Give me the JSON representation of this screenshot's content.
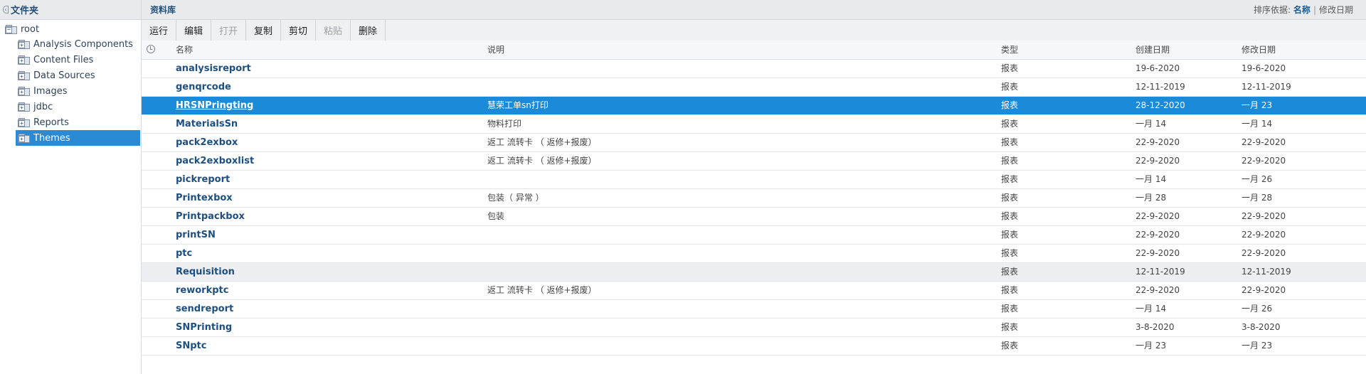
{
  "left_pane": {
    "title": "文件夹",
    "tree": [
      {
        "label": "root",
        "level": 0,
        "expanded": true,
        "selected": false
      },
      {
        "label": "Analysis Components",
        "level": 1,
        "expanded": false,
        "selected": false
      },
      {
        "label": "Content Files",
        "level": 1,
        "expanded": false,
        "selected": false
      },
      {
        "label": "Data Sources",
        "level": 1,
        "expanded": false,
        "selected": false
      },
      {
        "label": "Images",
        "level": 1,
        "expanded": false,
        "selected": false
      },
      {
        "label": "jdbc",
        "level": 1,
        "expanded": false,
        "selected": false
      },
      {
        "label": "Reports",
        "level": 1,
        "expanded": false,
        "selected": false
      },
      {
        "label": "Themes",
        "level": 1,
        "expanded": false,
        "selected": true
      }
    ]
  },
  "header": {
    "title": "资料库",
    "sort_label": "排序依据:",
    "sort_by_name": "名称",
    "sort_separator": "|",
    "sort_by_date": "修改日期"
  },
  "toolbar": {
    "buttons": [
      {
        "label": "运行",
        "enabled": true
      },
      {
        "label": "编辑",
        "enabled": true
      },
      {
        "label": "打开",
        "enabled": false
      },
      {
        "label": "复制",
        "enabled": true
      },
      {
        "label": "剪切",
        "enabled": true
      },
      {
        "label": "粘贴",
        "enabled": false
      },
      {
        "label": "删除",
        "enabled": true
      }
    ]
  },
  "table": {
    "columns": {
      "name": "名称",
      "description": "说明",
      "type": "类型",
      "created": "创建日期",
      "modified": "修改日期"
    },
    "rows": [
      {
        "name": "analysisreport",
        "description": "",
        "type": "报表",
        "created": "19-6-2020",
        "modified": "19-6-2020",
        "state": "normal"
      },
      {
        "name": "genqrcode",
        "description": "",
        "type": "报表",
        "created": "12-11-2019",
        "modified": "12-11-2019",
        "state": "normal"
      },
      {
        "name": "HRSNPringting",
        "description": "慧荣工单sn打印",
        "type": "报表",
        "created": "28-12-2020",
        "modified": "一月 23",
        "state": "selected"
      },
      {
        "name": "MaterialsSn",
        "description": "物料打印",
        "type": "报表",
        "created": "一月 14",
        "modified": "一月 14",
        "state": "normal"
      },
      {
        "name": "pack2exbox",
        "description": "返工 流转卡 （ 返修+报废）",
        "type": "报表",
        "created": "22-9-2020",
        "modified": "22-9-2020",
        "state": "normal"
      },
      {
        "name": "pack2exboxlist",
        "description": "返工 流转卡 （ 返修+报废）",
        "type": "报表",
        "created": "22-9-2020",
        "modified": "22-9-2020",
        "state": "normal"
      },
      {
        "name": "pickreport",
        "description": "",
        "type": "报表",
        "created": "一月 14",
        "modified": "一月 26",
        "state": "normal"
      },
      {
        "name": "Printexbox",
        "description": "包装（ 异常 ）",
        "type": "报表",
        "created": "一月 28",
        "modified": "一月 28",
        "state": "normal"
      },
      {
        "name": "Printpackbox",
        "description": "包装",
        "type": "报表",
        "created": "22-9-2020",
        "modified": "22-9-2020",
        "state": "normal"
      },
      {
        "name": "printSN",
        "description": "",
        "type": "报表",
        "created": "22-9-2020",
        "modified": "22-9-2020",
        "state": "normal"
      },
      {
        "name": "ptc",
        "description": "",
        "type": "报表",
        "created": "22-9-2020",
        "modified": "22-9-2020",
        "state": "normal"
      },
      {
        "name": "Requisition",
        "description": "",
        "type": "报表",
        "created": "12-11-2019",
        "modified": "12-11-2019",
        "state": "hover"
      },
      {
        "name": "reworkptc",
        "description": "返工 流转卡 （ 返修+报废）",
        "type": "报表",
        "created": "22-9-2020",
        "modified": "22-9-2020",
        "state": "normal"
      },
      {
        "name": "sendreport",
        "description": "",
        "type": "报表",
        "created": "一月 14",
        "modified": "一月 26",
        "state": "normal"
      },
      {
        "name": "SNPrinting",
        "description": "",
        "type": "报表",
        "created": "3-8-2020",
        "modified": "3-8-2020",
        "state": "normal"
      },
      {
        "name": "SNptc",
        "description": "",
        "type": "报表",
        "created": "一月 23",
        "modified": "一月 23",
        "state": "normal"
      }
    ]
  },
  "colors": {
    "selection": "#1b8ad8",
    "tree_selection": "#2a8ad4",
    "link_text": "#1f4f7e",
    "header_bg": "#e9eaec"
  }
}
